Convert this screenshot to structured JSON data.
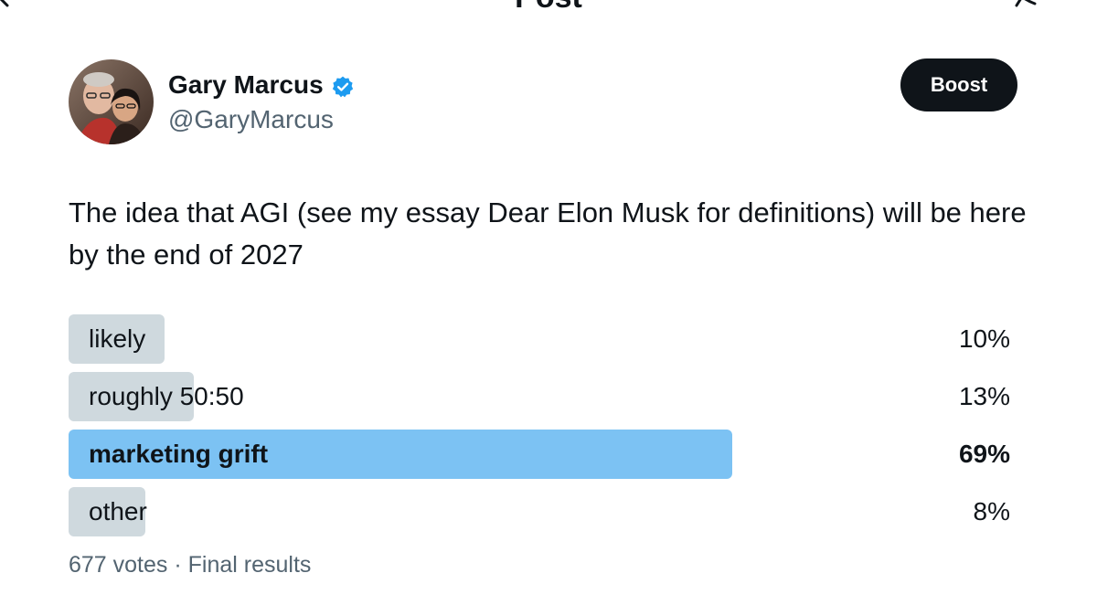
{
  "header": {
    "title": "Post"
  },
  "author": {
    "name": "Gary Marcus",
    "handle": "@GaryMarcus",
    "verified": true
  },
  "actions": {
    "boost_label": "Boost"
  },
  "post": {
    "text": "The idea that AGI (see my essay Dear Elon Musk for definitions) will be here by the end of 2027"
  },
  "poll": {
    "options": [
      {
        "label": "likely",
        "percent_label": "10%",
        "percent": 10,
        "winner": false
      },
      {
        "label": "roughly 50:50",
        "percent_label": "13%",
        "percent": 13,
        "winner": false
      },
      {
        "label": "marketing grift",
        "percent_label": "69%",
        "percent": 69,
        "winner": true
      },
      {
        "label": "other",
        "percent_label": "8%",
        "percent": 8,
        "winner": false
      }
    ],
    "votes": "677 votes",
    "separator": "·",
    "status": "Final results"
  },
  "colors": {
    "accent": "#1d9bf0",
    "winner_bar": "#7cc2f3",
    "bar": "#cfd9de",
    "text": "#0f1419",
    "muted": "#536471"
  },
  "icons": {
    "back": "back-arrow-icon",
    "grok": "grok-icon",
    "verified": "verified-badge-icon"
  }
}
